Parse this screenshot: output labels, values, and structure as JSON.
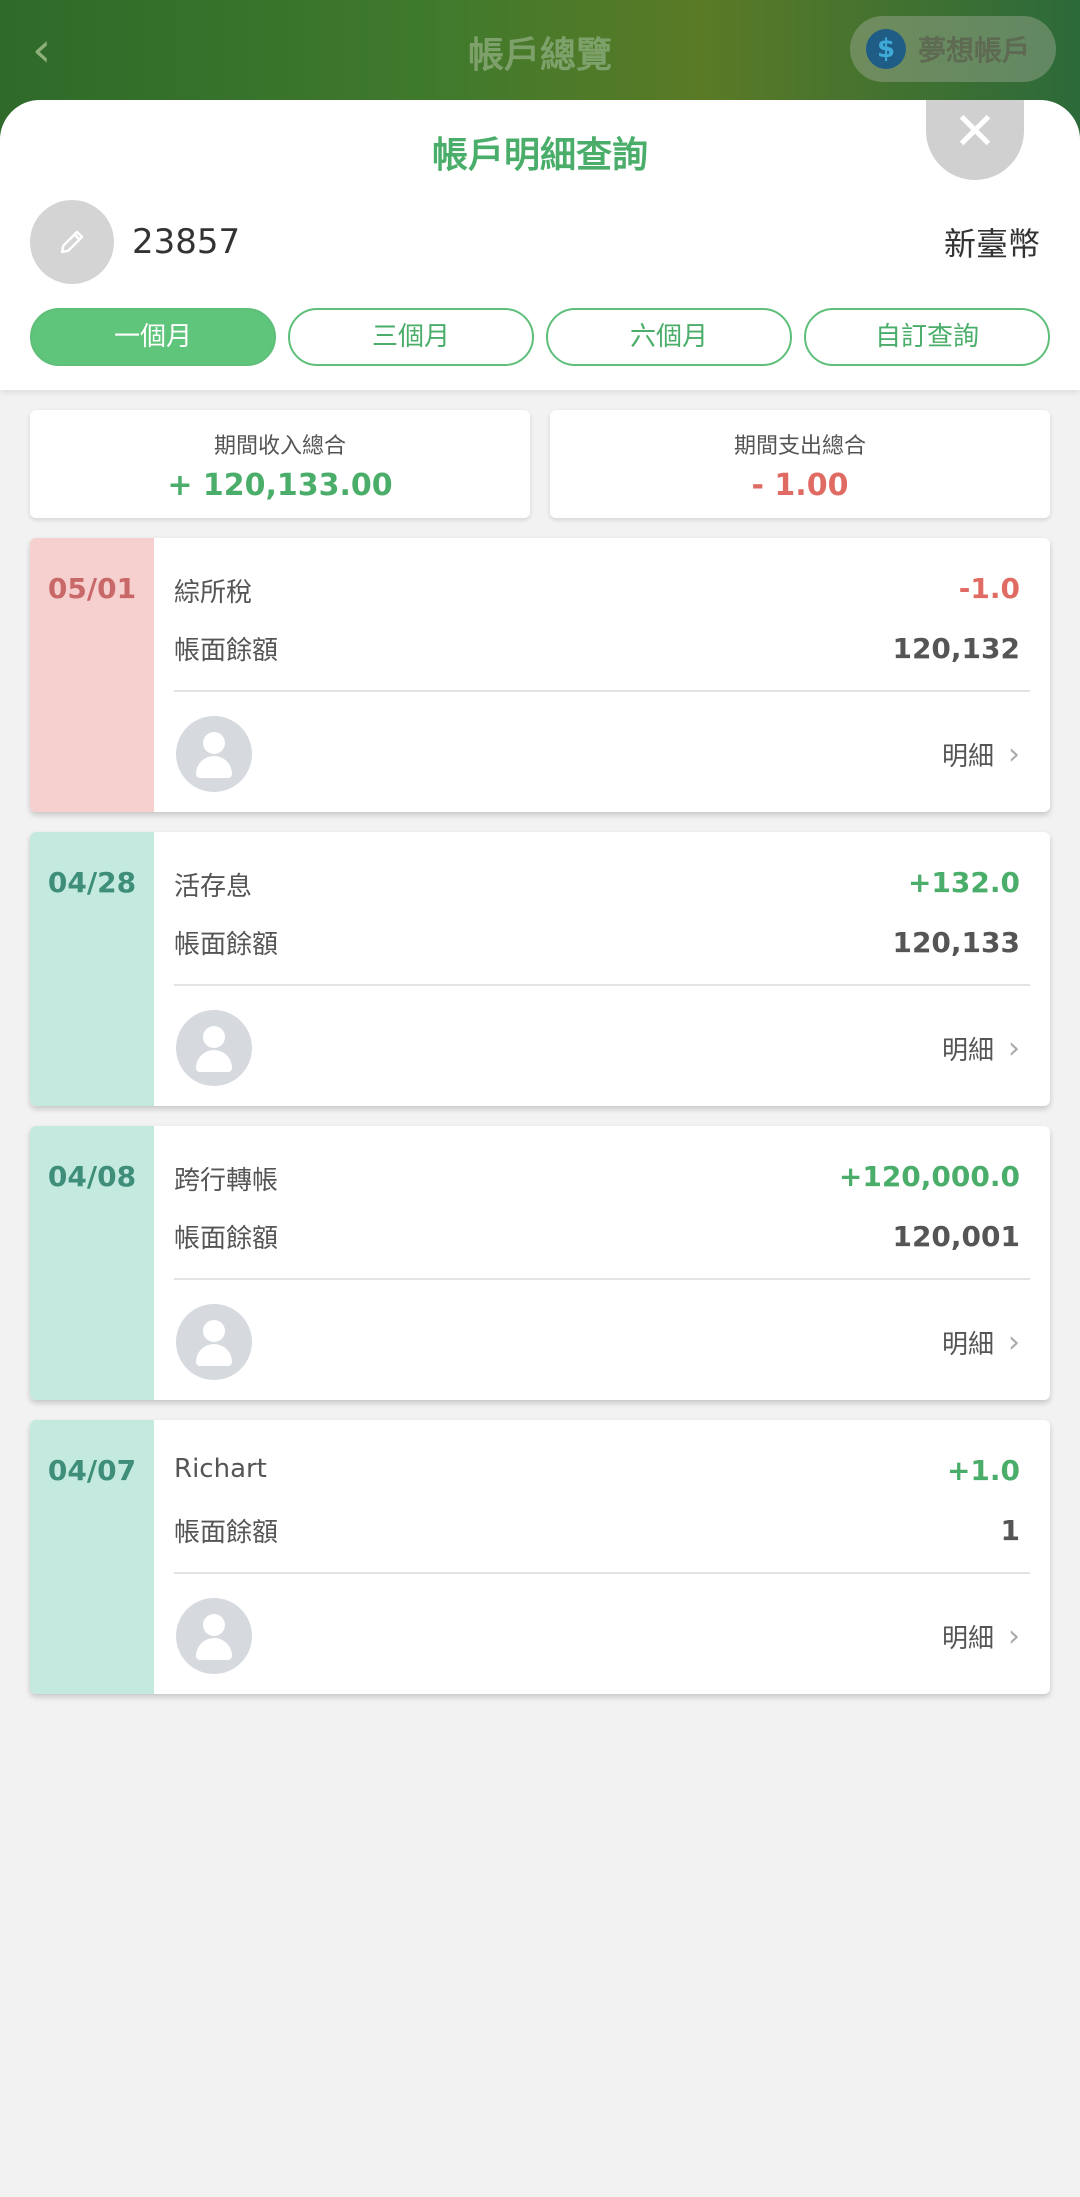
{
  "topbar": {
    "title": "帳戶總覽",
    "back_icon": "chevron-left-icon",
    "dream_label": "夢想帳戶",
    "dream_icon_glyph": "$"
  },
  "sheet": {
    "title": "帳戶明細查詢",
    "close_glyph": "✕",
    "account_number": "23857",
    "currency": "新臺幣",
    "tabs": [
      {
        "label": "一個月",
        "active": true
      },
      {
        "label": "三個月",
        "active": false
      },
      {
        "label": "六個月",
        "active": false
      },
      {
        "label": "自訂查詢",
        "active": false
      }
    ],
    "summary": {
      "income_label": "期間收入總合",
      "income_value": "+ 120,133.00",
      "expense_label": "期間支出總合",
      "expense_value": "- 1.00"
    },
    "transactions": [
      {
        "date": "05/01",
        "desc": "綜所稅",
        "amount": "-1.0",
        "balance_label": "帳面餘額",
        "balance": "120,132",
        "detail": "明細",
        "type": "neg"
      },
      {
        "date": "04/28",
        "desc": "活存息",
        "amount": "+132.0",
        "balance_label": "帳面餘額",
        "balance": "120,133",
        "detail": "明細",
        "type": "pos"
      },
      {
        "date": "04/08",
        "desc": "跨行轉帳",
        "amount": "+120,000.0",
        "balance_label": "帳面餘額",
        "balance": "120,001",
        "detail": "明細",
        "type": "pos"
      },
      {
        "date": "04/07",
        "desc": "Richart",
        "amount": "+1.0",
        "balance_label": "帳面餘額",
        "balance": "1",
        "detail": "明細",
        "type": "pos"
      }
    ]
  },
  "colors": {
    "green": "#4aae6a",
    "red": "#e06b63",
    "neg_bg": "#f6cfcf",
    "pos_bg": "#c4eadf"
  }
}
